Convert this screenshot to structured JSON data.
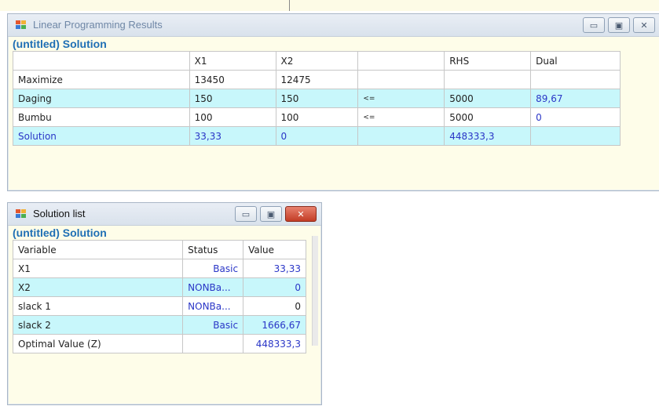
{
  "lp_window": {
    "title": "Linear Programming Results",
    "subtitle": "(untitled) Solution",
    "controls": {
      "minimize": "▭",
      "maximize": "▣",
      "close": "✕"
    },
    "columns": [
      "",
      "X1",
      "X2",
      "",
      "RHS",
      "Dual"
    ],
    "rows": [
      {
        "label": "Maximize",
        "x1": "13450",
        "x2": "12475",
        "op": "",
        "rhs": "",
        "dual": ""
      },
      {
        "label": "Daging",
        "x1": "150",
        "x2": "150",
        "op": "<=",
        "rhs": "5000",
        "dual": "89,67"
      },
      {
        "label": "Bumbu",
        "x1": "100",
        "x2": "100",
        "op": "<=",
        "rhs": "5000",
        "dual": "0"
      },
      {
        "label": "Solution",
        "x1": "33,33",
        "x2": "0",
        "op": "",
        "rhs": "448333,3",
        "dual": ""
      }
    ]
  },
  "sol_window": {
    "title": "Solution list",
    "subtitle": "(untitled) Solution",
    "controls": {
      "minimize": "▭",
      "maximize": "▣",
      "close": "✕"
    },
    "columns": [
      "Variable",
      "Status",
      "Value"
    ],
    "rows": [
      {
        "variable": "X1",
        "status": "Basic",
        "value": "33,33"
      },
      {
        "variable": "X2",
        "status": "NONBa...",
        "value": "0"
      },
      {
        "variable": "slack 1",
        "status": "NONBa...",
        "value": "0"
      },
      {
        "variable": "slack 2",
        "status": "Basic",
        "value": "1666,67"
      },
      {
        "variable": "Optimal Value (Z)",
        "status": "",
        "value": "448333,3"
      }
    ]
  },
  "colors": {
    "highlight_row": "#c8f7fb",
    "title_blue": "#1f6fb5",
    "value_blue": "#2a36c7",
    "close_red": "#c33c25"
  }
}
